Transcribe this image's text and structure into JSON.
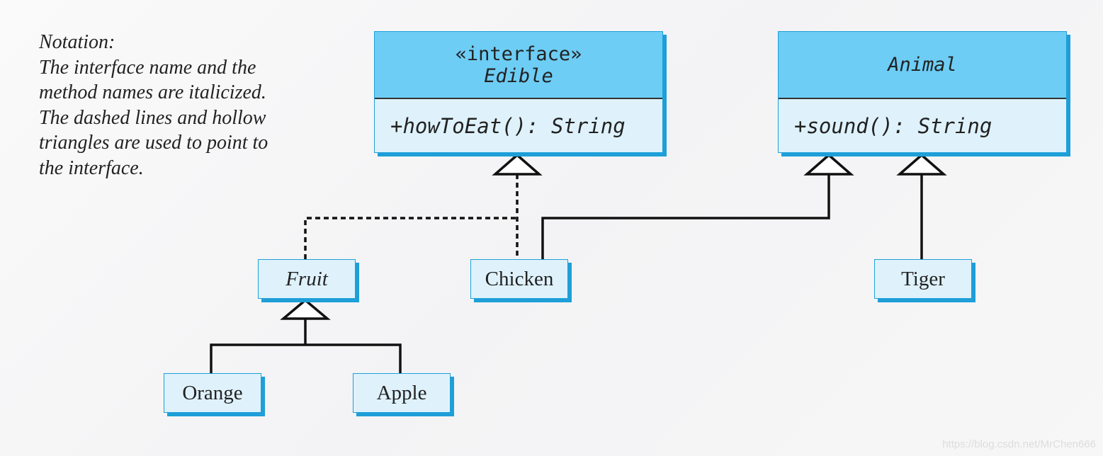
{
  "notation": [
    "Notation:",
    "The interface name and the",
    "method names are italicized.",
    "The dashed lines and hollow",
    "triangles are used to point to",
    "the interface."
  ],
  "edible": {
    "stereotype": "«interface»",
    "name": "Edible",
    "method": "+howToEat(): String"
  },
  "animal": {
    "name": "Animal",
    "method": "+sound(): String"
  },
  "classes": {
    "fruit": "Fruit",
    "chicken": "Chicken",
    "tiger": "Tiger",
    "orange": "Orange",
    "apple": "Apple"
  },
  "watermark": "https://blog.csdn.net/MrChen666",
  "colors": {
    "header": "#6dcdf5",
    "body": "#dff2fc",
    "shadow": "#1e9fd8"
  }
}
